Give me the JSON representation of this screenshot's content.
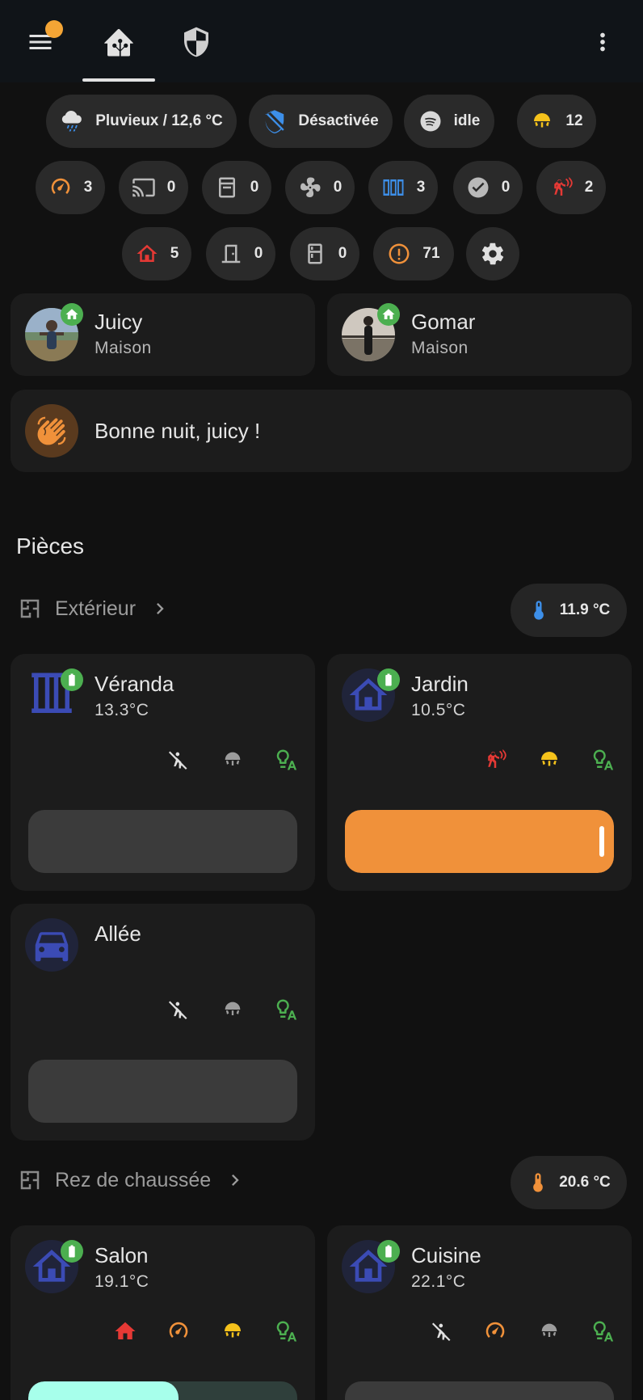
{
  "colors": {
    "accent_orange": "#f0913a",
    "accent_yellow": "#f5c21b",
    "accent_blue": "#3b5bb5",
    "accent_red": "#e53935",
    "green": "#4caf50",
    "notification": "#f4a535",
    "teal": "#a7ffeb"
  },
  "topbar": {
    "icons": [
      "menu-icon",
      "home-assistant-icon",
      "shield-icon",
      "more-vertical-icon"
    ]
  },
  "chips": {
    "weather": {
      "icon": "weather-pouring-icon",
      "label": "Pluvieux / 12,6 °C"
    },
    "alarm": {
      "icon": "shield-off-icon",
      "label": "Désactivée"
    },
    "spotify": {
      "icon": "spotify-icon",
      "label": "idle"
    },
    "lights": {
      "icon": "ceiling-light-icon",
      "label": "12"
    },
    "row2": [
      {
        "icon": "gauge-icon",
        "count": "3"
      },
      {
        "icon": "cast-icon",
        "count": "0"
      },
      {
        "icon": "dishwasher-icon",
        "count": "0"
      },
      {
        "icon": "fan-icon",
        "count": "0"
      },
      {
        "icon": "window-open-icon",
        "count": "3"
      },
      {
        "icon": "check-circle-icon",
        "count": "0"
      },
      {
        "icon": "motion-sensor-icon",
        "count": "2"
      }
    ],
    "row3": [
      {
        "icon": "home-icon",
        "count": "5"
      },
      {
        "icon": "door-icon",
        "count": "0"
      },
      {
        "icon": "fridge-icon",
        "count": "0"
      },
      {
        "icon": "alert-circle-icon",
        "count": "71"
      },
      {
        "icon": "gear-icon",
        "count": ""
      }
    ]
  },
  "persons": [
    {
      "name": "Juicy",
      "state": "Maison"
    },
    {
      "name": "Gomar",
      "state": "Maison"
    }
  ],
  "greeting": {
    "icon": "hand-wave-icon",
    "text": "Bonne nuit, juicy !"
  },
  "section": {
    "title": "Pièces"
  },
  "areas": [
    {
      "name": "Extérieur",
      "temperature": "11.9 °C"
    },
    {
      "name": "Rez de chaussée",
      "temperature": "20.6 °C"
    }
  ],
  "rooms": [
    {
      "name": "Véranda",
      "temp": "13.3°C",
      "icon": "window-shutter-icon",
      "status_icons": [
        "motion-sensor-off-icon",
        "ceiling-light-off-icon",
        "lightbulb-auto-icon"
      ],
      "slider": 0
    },
    {
      "name": "Jardin",
      "temp": "10.5°C",
      "icon": "home-outline-icon",
      "status_icons": [
        "motion-sensor-icon",
        "ceiling-light-on-icon",
        "lightbulb-auto-icon"
      ],
      "slider": 1.0
    },
    {
      "name": "Allée",
      "temp": "",
      "icon": "car-icon",
      "status_icons": [
        "motion-sensor-off-icon",
        "ceiling-light-off-icon",
        "lightbulb-auto-icon"
      ],
      "slider": 0
    },
    {
      "name": "Salon",
      "temp": "19.1°C",
      "icon": "home-outline-icon",
      "status_icons": [
        "home-icon",
        "gauge-icon",
        "ceiling-light-on-icon",
        "lightbulb-auto-icon"
      ],
      "slider": 0.56
    },
    {
      "name": "Cuisine",
      "temp": "22.1°C",
      "icon": "home-outline-icon",
      "status_icons": [
        "motion-sensor-off-icon",
        "gauge-icon",
        "ceiling-light-off-icon",
        "lightbulb-auto-icon"
      ],
      "slider": 0
    }
  ]
}
